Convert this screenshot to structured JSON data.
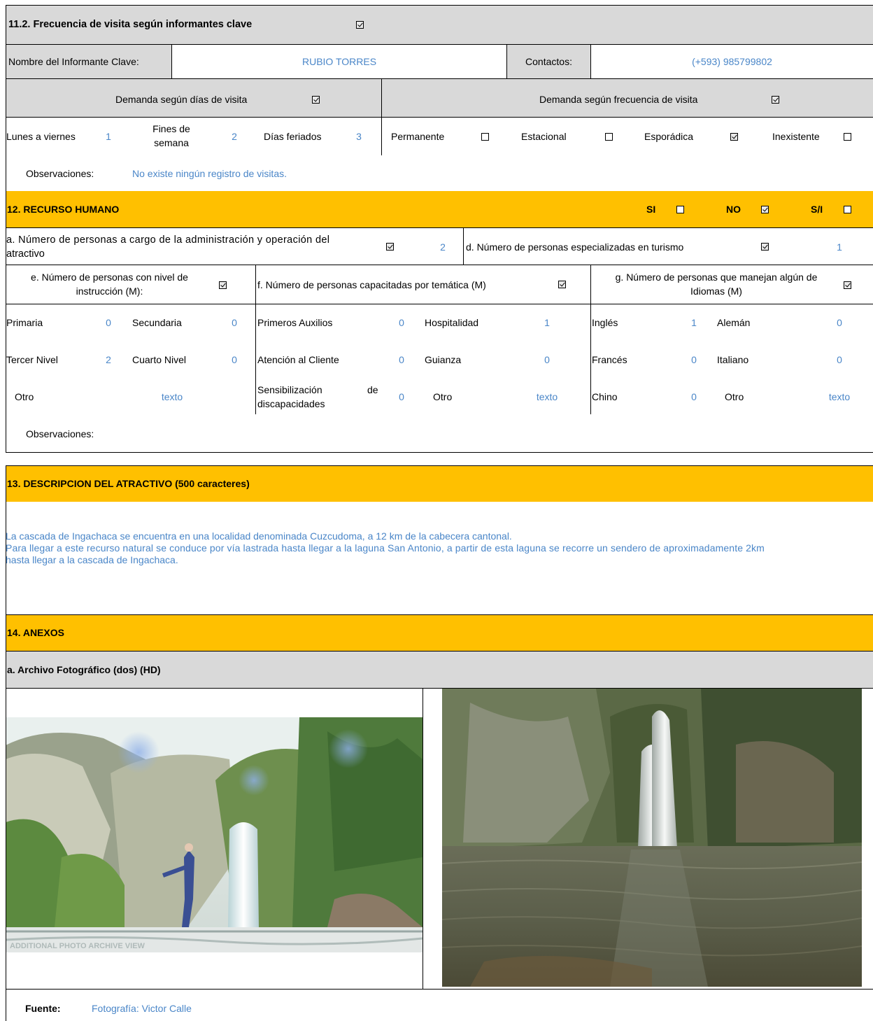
{
  "s11": {
    "title": "11.2. Frecuencia de visita según informantes clave",
    "informant_label": "Nombre del Informante Clave:",
    "informant_value": "RUBIO TORRES",
    "contacts_label": "Contactos:",
    "contacts_value": "(+593) 985799802",
    "days_header": "Demanda según  días de visita",
    "freq_header": "Demanda según frecuencia de visita",
    "weekdays_label": "Lunes a viernes",
    "weekdays_value": "1",
    "weekend_label_1": "Fines de",
    "weekend_label_2": "semana",
    "weekend_value": "2",
    "holidays_label": "Días feriados",
    "holidays_value": "3",
    "permanent_label": "Permanente",
    "seasonal_label": "Estacional",
    "sporadic_label": "Esporádica",
    "nonexistent_label": "Inexistente",
    "obs_label": "Observaciones:",
    "obs_value": "No existe ningún registro de visitas."
  },
  "s12": {
    "title": "12. RECURSO HUMANO",
    "si_label": "SI",
    "no_label": "NO",
    "sn_label": "S/I",
    "a_label_1": "a. Número de personas a cargo de la administración y operación del",
    "a_label_2": "atractivo",
    "a_value": "2",
    "d_label": "d. Número de personas especializadas en turismo",
    "d_value": "1",
    "e_label_1": "e. Número de personas con nivel de",
    "e_label_2": "instrucción (M):",
    "f_label": "f. Número de personas capacitadas por temática (M)",
    "g_label_1": "g. Número de personas que manejan algún de",
    "g_label_2": "Idiomas (M)",
    "primaria_label": "Primaria",
    "primaria_value": "0",
    "secundaria_label": "Secundaria",
    "secundaria_value": "0",
    "tercer_label": "Tercer Nivel",
    "tercer_value": "2",
    "cuarto_label": "Cuarto Nivel",
    "cuarto_value": "0",
    "otro_e_label": "Otro",
    "otro_e_value": "texto",
    "auxilios_label": "Primeros Auxilios",
    "auxilios_value": "0",
    "hospitalidad_label": "Hospitalidad",
    "hospitalidad_value": "1",
    "atencion_label": "Atención al Cliente",
    "atencion_value": "0",
    "guianza_label": "Guianza",
    "guianza_value": "0",
    "sensib_label_1": "Sensibilización",
    "sensib_label_de": "de",
    "sensib_label_2": "discapacidades",
    "sensib_value": "0",
    "otro_f_label": "Otro",
    "otro_f_value": "texto",
    "ingles_label": "Inglés",
    "ingles_value": "1",
    "aleman_label": "Alemán",
    "aleman_value": "0",
    "frances_label": "Francés",
    "frances_value": "0",
    "italiano_label": "Italiano",
    "italiano_value": "0",
    "chino_label": "Chino",
    "chino_value": "0",
    "otro_g_label": "Otro",
    "otro_g_value": "texto",
    "obs_label": "Observaciones:"
  },
  "s13": {
    "title": "13. DESCRIPCION DEL ATRACTIVO (500 caracteres)",
    "line1": "La cascada de Ingachaca se encuentra en una localidad denominada Cuzcudoma, a 12 km de la cabecera cantonal.",
    "line2": "Para llegar a este recurso natural se conduce por vía lastrada hasta llegar a la laguna San Antonio, a partir de esta laguna se recorre un sendero de aproximadamente 2km",
    "line3": "hasta llegar a la cascada de Ingachaca."
  },
  "s14": {
    "title": "14. ANEXOS",
    "photo_header": "a. Archivo Fotográfico (dos) (HD)",
    "photo1_watermark": "ADDITIONAL PHOTO ARCHIVE VIEW",
    "source_label": "Fuente:",
    "source_value": "Fotografía: Victor Calle"
  }
}
